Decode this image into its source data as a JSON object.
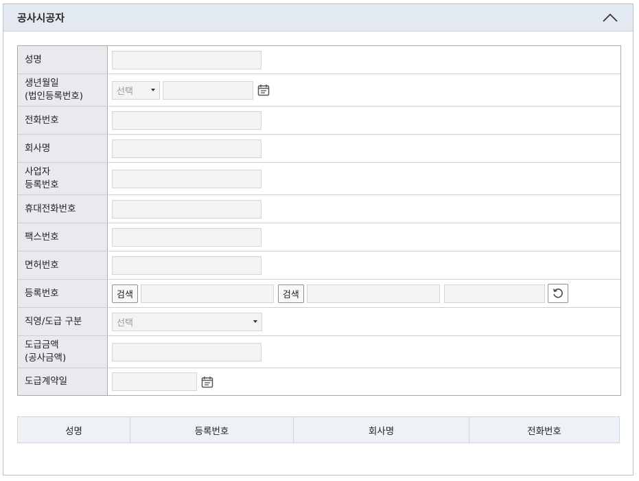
{
  "panel": {
    "title": "공사시공자"
  },
  "form": {
    "name_label": "성명",
    "birth_label_line1": "생년월일",
    "birth_label_line2": "(법인등록번호)",
    "birth_select": "선택",
    "phone_label": "전화번호",
    "company_label": "회사명",
    "bizno_label_line1": "사업자",
    "bizno_label_line2": "등록번호",
    "mobile_label": "휴대전화번호",
    "fax_label": "팩스번호",
    "license_label": "면허번호",
    "regno_label": "등록번호",
    "search_button_1": "검색",
    "search_button_2": "검색",
    "contract_type_label": "직영/도급 구분",
    "contract_type_select": "선택",
    "amount_label_line1": "도급금액",
    "amount_label_line2": "(공사금액)",
    "contract_date_label": "도급계약일"
  },
  "list": {
    "columns": [
      "성명",
      "등록번호",
      "회사명",
      "전화번호"
    ]
  }
}
